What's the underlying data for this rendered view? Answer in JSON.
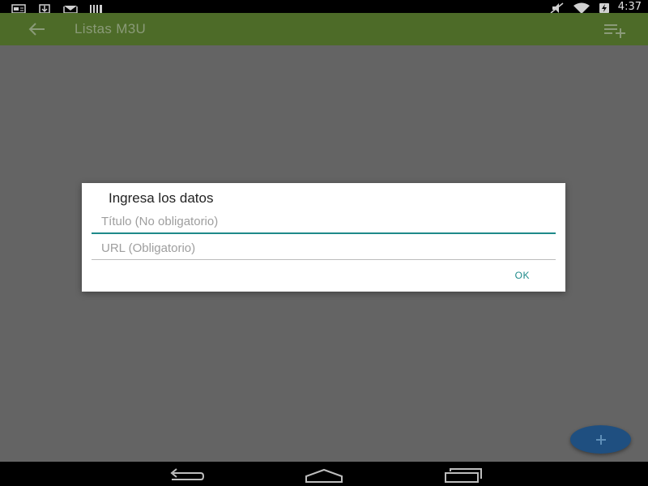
{
  "status_bar": {
    "time": "4:37",
    "left_icons": [
      "notification-card-icon",
      "download-icon",
      "mail-icon",
      "barcode-icon"
    ],
    "right_icons": [
      "mute-icon",
      "wifi-icon",
      "battery-charging-icon"
    ]
  },
  "app_bar": {
    "title": "Listas M3U",
    "color": "#4d6b28",
    "actions": [
      "back-arrow-icon",
      "playlist-add-icon"
    ]
  },
  "dialog": {
    "title": "Ingresa los datos",
    "fields": [
      {
        "placeholder": "Título (No obligatorio)",
        "value": ""
      },
      {
        "placeholder": "URL (Obligatorio)",
        "value": ""
      }
    ],
    "ok_label": "OK",
    "accent": "#1e8a8a"
  },
  "fab": {
    "icon": "plus-icon",
    "color": "#1f4f80"
  },
  "nav_bar": {
    "buttons": [
      "back-icon",
      "home-icon",
      "recents-icon"
    ]
  }
}
